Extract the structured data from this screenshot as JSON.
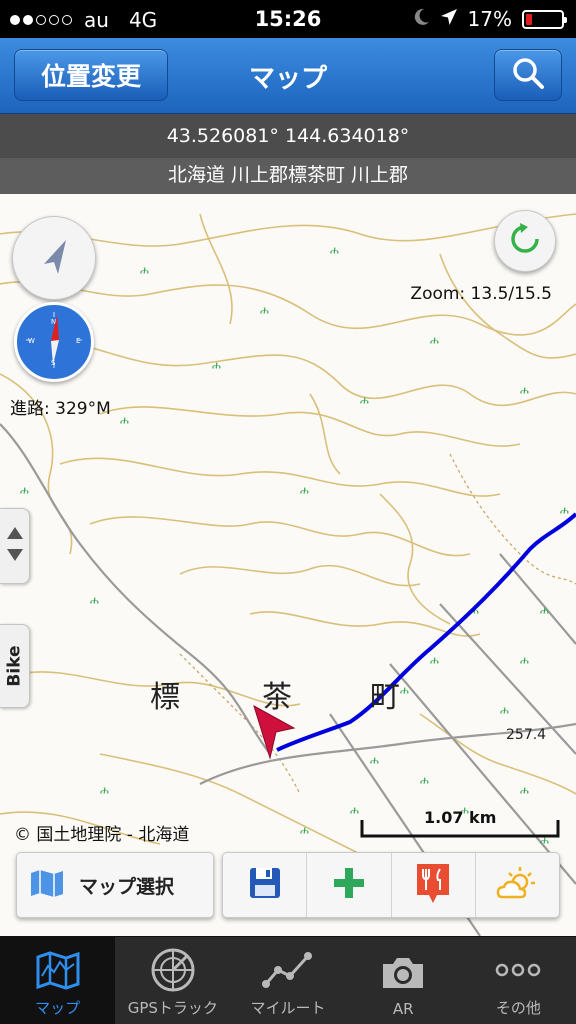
{
  "status_bar": {
    "carrier": "au",
    "network": "4G",
    "time": "15:26",
    "battery": "17%",
    "battery_level": 0.17,
    "signal_bars_filled": 2,
    "signal_bars_total": 5
  },
  "nav": {
    "change_location_label": "位置変更",
    "title": "マップ",
    "search_icon": "search-icon"
  },
  "location": {
    "coordinates": "43.526081° 144.634018°",
    "address": "北海道 川上郡標茶町 川上郡"
  },
  "map": {
    "zoom_label": "Zoom: 13.5/15.5",
    "heading_label": "進路: 329°M",
    "copyright": "© 国土地理院 - 北海道",
    "scale_label": "1.07 km",
    "bike_tab_label": "Bike",
    "place_name_chars": [
      "標",
      "茶",
      "町"
    ],
    "elevation_label": "257.4",
    "route_color": "#0000dd",
    "position_marker_color": "#d0103c"
  },
  "toolbar": {
    "map_select_label": "マップ選択",
    "buttons": [
      "save-icon",
      "add-icon",
      "restaurant-icon",
      "weather-icon"
    ]
  },
  "tabs": [
    {
      "label": "マップ",
      "icon": "map-icon",
      "active": true
    },
    {
      "label": "GPSトラック",
      "icon": "radar-icon",
      "active": false
    },
    {
      "label": "マイルート",
      "icon": "route-icon",
      "active": false
    },
    {
      "label": "AR",
      "icon": "camera-icon",
      "active": false
    },
    {
      "label": "その他",
      "icon": "more-icon",
      "active": false
    }
  ]
}
